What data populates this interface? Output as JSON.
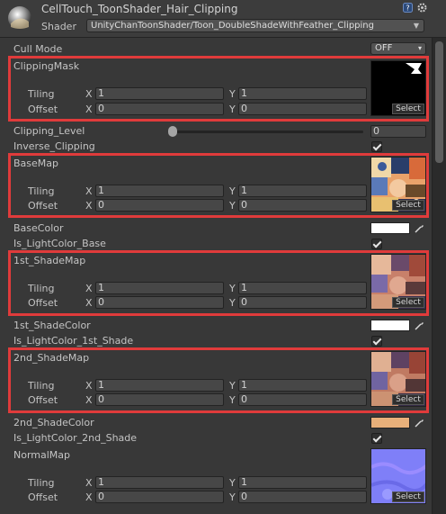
{
  "header": {
    "title": "CellTouch_ToonShader_Hair_Clipping",
    "shader_label": "Shader",
    "shader_value": "UnityChanToonShader/Toon_DoubleShadeWithFeather_Clipping"
  },
  "cull_mode": {
    "label": "Cull Mode",
    "value": "OFF"
  },
  "clipping_mask": {
    "label": "ClippingMask",
    "tiling_label": "Tiling",
    "offset_label": "Offset",
    "tiling_x": "1",
    "tiling_y": "1",
    "offset_x": "0",
    "offset_y": "0",
    "select_label": "Select"
  },
  "clipping_level": {
    "label": "Clipping_Level",
    "value": "0"
  },
  "inverse_clipping": {
    "label": "Inverse_Clipping"
  },
  "base_map": {
    "label": "BaseMap",
    "tiling_label": "Tiling",
    "offset_label": "Offset",
    "tiling_x": "1",
    "tiling_y": "1",
    "offset_x": "0",
    "offset_y": "0",
    "select_label": "Select"
  },
  "base_color": {
    "label": "BaseColor",
    "color": "#ffffff"
  },
  "is_lightcolor_base": {
    "label": "Is_LightColor_Base"
  },
  "shade_map_1": {
    "label": "1st_ShadeMap",
    "tiling_label": "Tiling",
    "offset_label": "Offset",
    "tiling_x": "1",
    "tiling_y": "1",
    "offset_x": "0",
    "offset_y": "0",
    "select_label": "Select"
  },
  "shade_color_1": {
    "label": "1st_ShadeColor",
    "color": "#ffffff"
  },
  "is_lightcolor_1st": {
    "label": "Is_LightColor_1st_Shade"
  },
  "shade_map_2": {
    "label": "2nd_ShadeMap",
    "tiling_label": "Tiling",
    "offset_label": "Offset",
    "tiling_x": "1",
    "tiling_y": "1",
    "offset_x": "0",
    "offset_y": "0",
    "select_label": "Select"
  },
  "shade_color_2": {
    "label": "2nd_ShadeColor",
    "color": "#e8b07a"
  },
  "is_lightcolor_2nd": {
    "label": "Is_LightColor_2nd_Shade"
  },
  "normal_map": {
    "label": "NormalMap",
    "tiling_label": "Tiling",
    "offset_label": "Offset",
    "tiling_x": "1",
    "tiling_y": "1",
    "offset_x": "0",
    "offset_y": "0",
    "select_label": "Select"
  },
  "axis": {
    "x": "X",
    "y": "Y"
  },
  "colors": {
    "highlight": "#e03b3b",
    "panel": "#383838"
  },
  "icons": [
    "material-icon",
    "help-icon",
    "gear-icon",
    "chevron-down-icon",
    "eyedropper-icon",
    "checkmark-icon"
  ]
}
